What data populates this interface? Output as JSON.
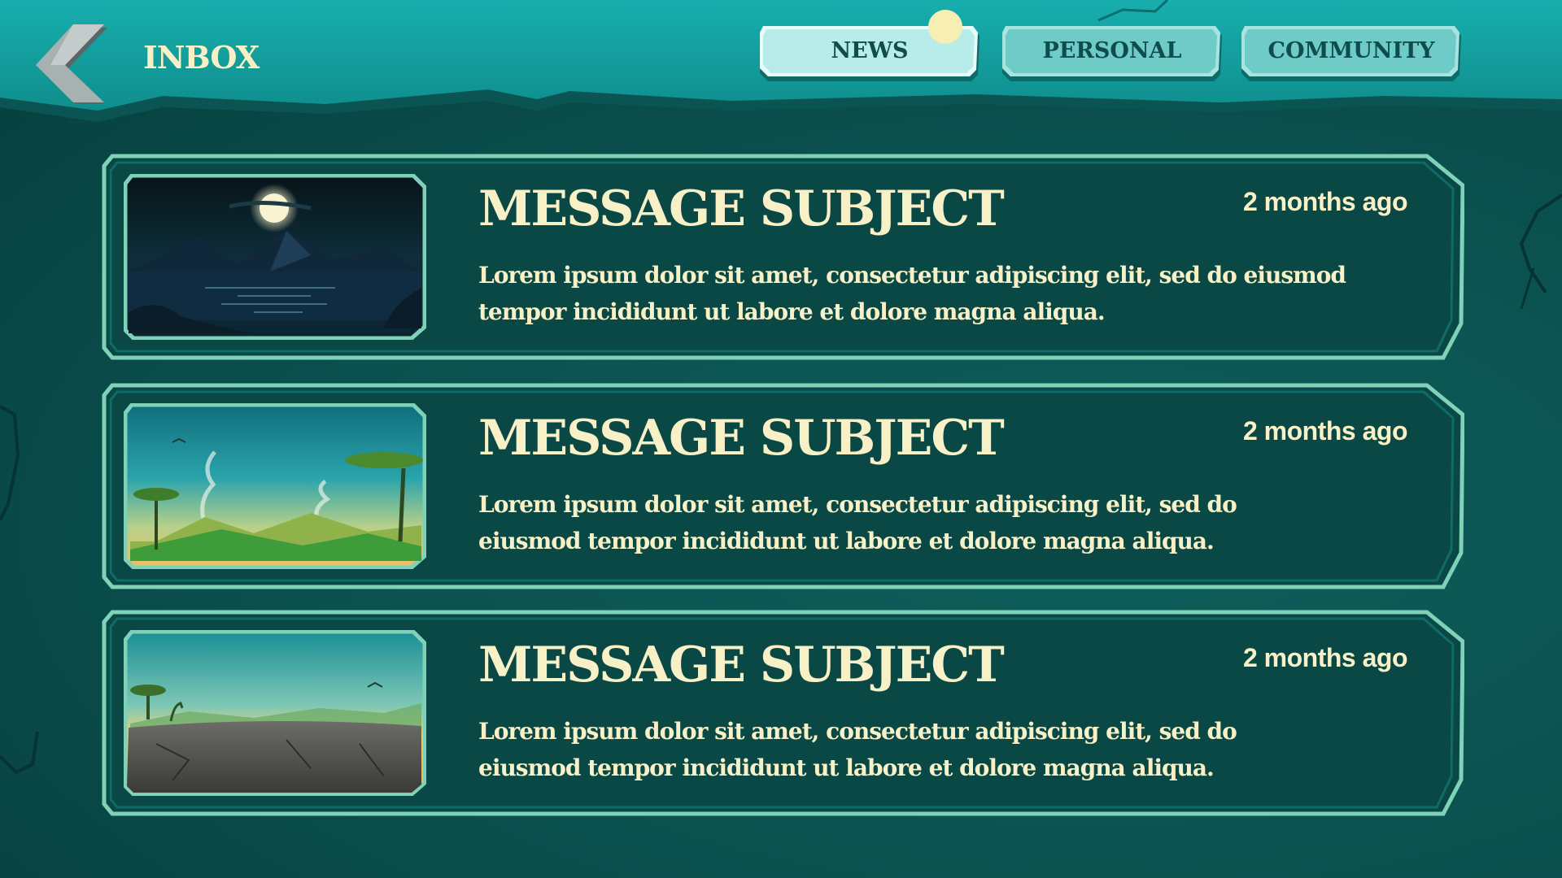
{
  "header": {
    "title": "INBOX",
    "back_icon": "back-chevron-icon",
    "tabs": [
      {
        "label": "NEWS",
        "active": true,
        "notification": true
      },
      {
        "label": "PERSONAL",
        "active": false
      },
      {
        "label": "COMMUNITY",
        "active": false
      }
    ]
  },
  "messages": [
    {
      "subject": "MESSAGE SUBJECT",
      "time": "2 months ago",
      "body": "Lorem ipsum dolor sit amet, consectetur adipiscing elit, sed do eiusmod tempor incididunt ut labore et dolore magna aliqua.",
      "thumbnail": "night-moon-lake-thumbnail"
    },
    {
      "subject": "MESSAGE SUBJECT",
      "time": "2 months ago",
      "body": "Lorem ipsum dolor sit amet, consectetur adipiscing elit, sed do eiusmod tempor incididunt ut labore et dolore magna aliqua.",
      "thumbnail": "savanna-volcano-thumbnail"
    },
    {
      "subject": "MESSAGE SUBJECT",
      "time": "2 months ago",
      "body": "Lorem ipsum dolor sit amet, consectetur adipiscing elit, sed do eiusmod tempor incididunt ut labore et dolore magna aliqua.",
      "thumbnail": "rocky-plateau-thumbnail"
    }
  ],
  "colors": {
    "text": "#f8f0c6",
    "frame_border": "#7fd1b8",
    "panel": "#0b4b4a",
    "header": "#15a3a3",
    "tab": "#8fdfdc",
    "notification": "#f6eeb3"
  }
}
